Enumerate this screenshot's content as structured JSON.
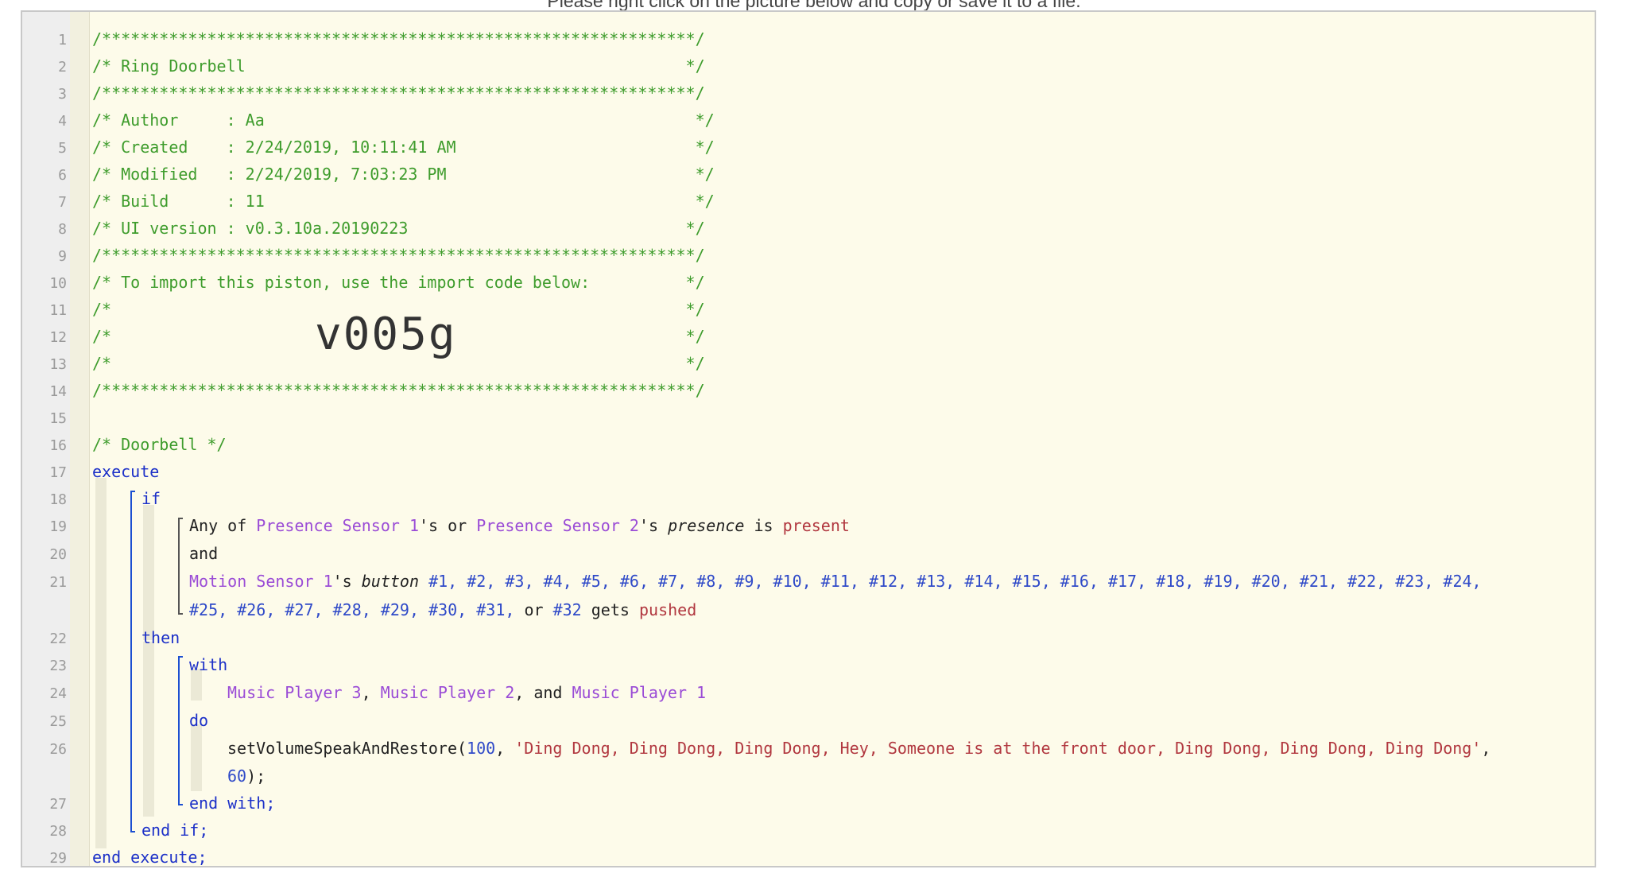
{
  "hint": "Please right click on the picture below and copy or save it to a file.",
  "import_code": "v005g",
  "lines": [
    {
      "n": "1"
    },
    {
      "n": "2"
    },
    {
      "n": "3"
    },
    {
      "n": "4"
    },
    {
      "n": "5"
    },
    {
      "n": "6"
    },
    {
      "n": "7"
    },
    {
      "n": "8"
    },
    {
      "n": "9"
    },
    {
      "n": "10"
    },
    {
      "n": "11"
    },
    {
      "n": "12"
    },
    {
      "n": "13"
    },
    {
      "n": "14"
    },
    {
      "n": "15"
    },
    {
      "n": "16"
    },
    {
      "n": "17"
    },
    {
      "n": "18"
    },
    {
      "n": "19"
    },
    {
      "n": "20"
    },
    {
      "n": "21"
    },
    {
      "n": "22"
    },
    {
      "n": "23"
    },
    {
      "n": "24"
    },
    {
      "n": "25"
    },
    {
      "n": "26"
    },
    {
      "n": "27"
    },
    {
      "n": "28"
    },
    {
      "n": "29"
    }
  ],
  "header": {
    "stars": "/**************************************************************/",
    "title": "/* Ring Doorbell                                              */",
    "author": "/* Author     : Aa                                             */",
    "created": "/* Created    : 2/24/2019, 10:11:41 AM                         */",
    "modified": "/* Modified   : 2/24/2019, 7:03:23 PM                          */",
    "build": "/* Build      : 11                                             */",
    "ui_version": "/* UI version : v0.3.10a.20190223                             */",
    "import_note": "/* To import this piston, use the import code below:          */",
    "blank": "/*                                                            */"
  },
  "code": {
    "comment_doorbell": "/* Doorbell */",
    "execute": "execute",
    "if": "if",
    "any_of": "Any of",
    "presence_sensor_1": "Presence Sensor 1",
    "apos_s_or": "'s or",
    "presence_sensor_2": "Presence Sensor 2",
    "apos_s": "'s",
    "presence": "presence",
    "is": "is",
    "present": "present",
    "and": "and",
    "motion_sensor_1": "Motion Sensor 1",
    "button": "button",
    "buttons_line1": "#1, #2, #3, #4, #5, #6, #7, #8, #9, #10, #11, #12, #13, #14, #15, #16, #17, #18, #19, #20, #21, #22, #23, #24,",
    "buttons_line2a": "#25, #26, #27, #28, #29, #30, #31,",
    "or": "or",
    "button_32": "#32",
    "gets": "gets",
    "pushed": "pushed",
    "then": "then",
    "with": "with",
    "music_player_3": "Music Player 3",
    "comma": ",",
    "music_player_2": "Music Player 2",
    "comma_and": ", and",
    "music_player_1": "Music Player 1",
    "do": "do",
    "fn": "setVolumeSpeakAndRestore(",
    "arg_volume": "100",
    "arg_sep": ", ",
    "arg_message": "'Ding Dong, Ding Dong, Ding Dong, Hey, Someone is at the front door, Ding Dong, Ding Dong, Ding Dong'",
    "arg_sep2": ",",
    "arg_delay": "60",
    "fn_close": ");",
    "end_with": "end with;",
    "end_if": "end if;",
    "end_execute": "end execute;"
  }
}
